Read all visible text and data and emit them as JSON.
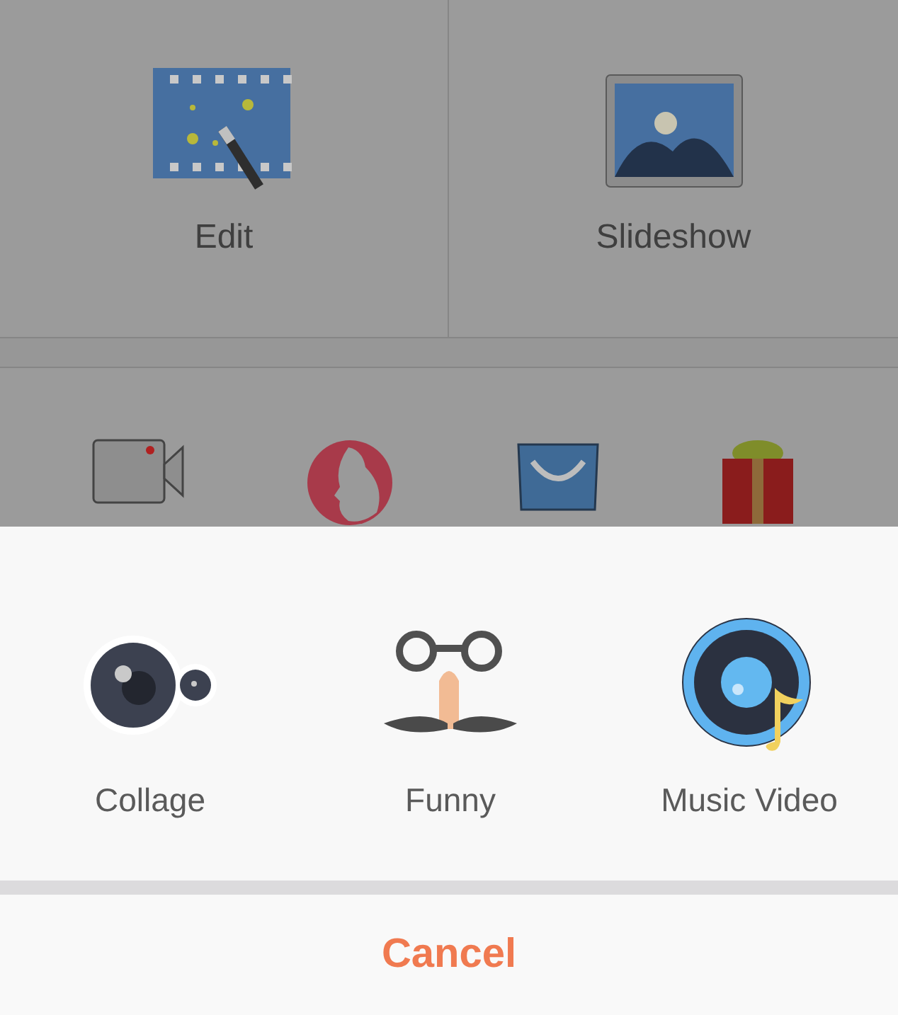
{
  "app": {
    "tiles": [
      {
        "label": "Edit",
        "kind": "edit"
      },
      {
        "label": "Slideshow",
        "kind": "slideshow"
      }
    ],
    "shortcuts": [
      {
        "kind": "camera"
      },
      {
        "kind": "portrait"
      },
      {
        "kind": "bag"
      },
      {
        "kind": "gift"
      }
    ]
  },
  "sheet": {
    "options": [
      {
        "label": "Collage",
        "kind": "collage"
      },
      {
        "label": "Funny",
        "kind": "funny"
      },
      {
        "label": "Music Video",
        "kind": "music"
      }
    ],
    "cancel": "Cancel"
  }
}
